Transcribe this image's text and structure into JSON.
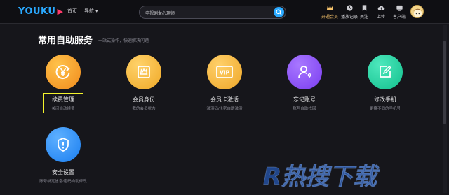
{
  "header": {
    "logo_text": "YOUKU",
    "logo_mark": "▶",
    "nav": [
      "首页",
      "导航"
    ],
    "search_value": "电视剧女心理师",
    "tools": [
      {
        "label": "开通会员",
        "icon": "vip-crown-icon",
        "color": "#f5c26b"
      },
      {
        "label": "播放记录",
        "icon": "history-clock-icon"
      },
      {
        "label": "关注",
        "icon": "bookmark-icon"
      },
      {
        "label": "上传",
        "icon": "upload-cloud-icon"
      },
      {
        "label": "客户端",
        "icon": "download-client-icon"
      }
    ]
  },
  "section": {
    "title": "常用自助服务",
    "subtitle": "一站式操作，快速解决问题"
  },
  "services": [
    {
      "name": "续费管理",
      "desc": "关闭自动续费",
      "icon": "yen-refresh-icon",
      "color": "#f5a623"
    },
    {
      "name": "会员身份",
      "desc": "我的会员状态",
      "icon": "crown-card-icon",
      "color": "#f3b53c"
    },
    {
      "name": "会员卡激活",
      "desc": "激活码/卡密自助激活",
      "icon": "vip-card-icon",
      "color": "#f2b43a"
    },
    {
      "name": "忘记账号",
      "desc": "账号自助找回",
      "icon": "user-search-icon",
      "color": "#8a4dff"
    },
    {
      "name": "修改手机",
      "desc": "更换不同的手机号",
      "icon": "edit-phone-icon",
      "color": "#1fd3a0"
    },
    {
      "name": "安全设置",
      "desc": "账号绑定信息/密码自助修改",
      "icon": "shield-alert-icon",
      "color": "#2a90ff"
    }
  ],
  "watermark_text": "R热搜下载"
}
